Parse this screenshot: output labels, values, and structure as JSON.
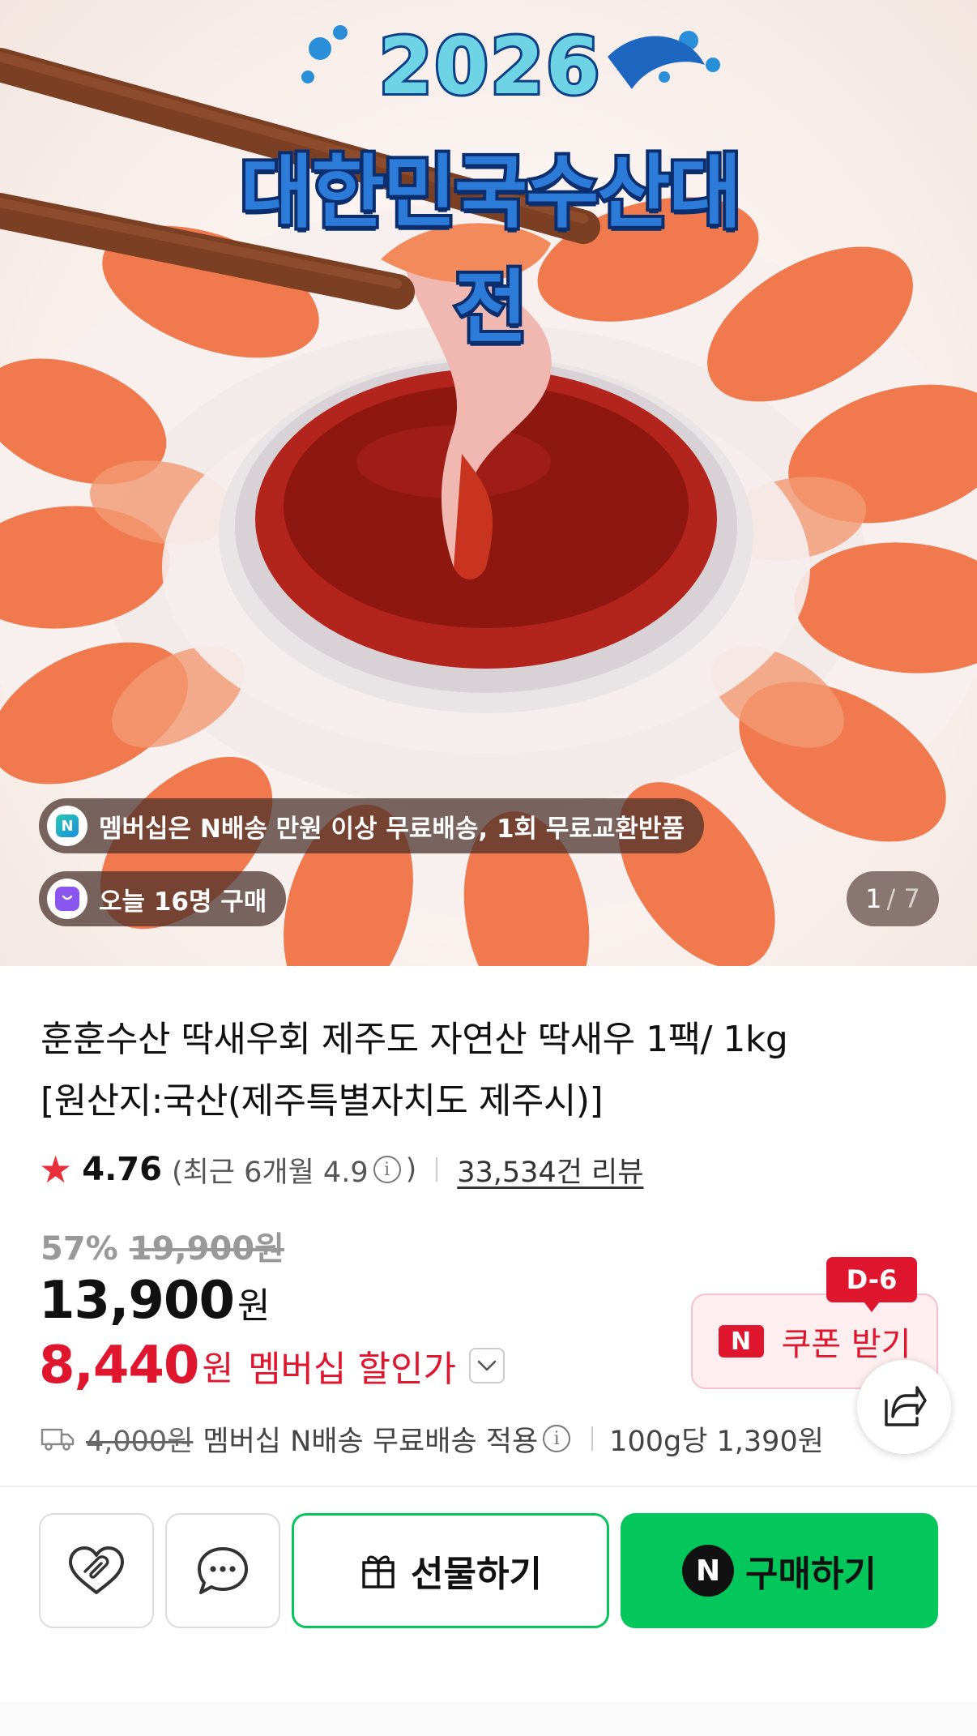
{
  "hero": {
    "event_year": "2026",
    "event_title": "대한민국수산대전",
    "membership_badge": "멤버십은 N배송 만원 이상 무료배송, 1회 무료교환반품",
    "today_purchase": "오늘 16명 구매",
    "image_index": "1",
    "image_total": "/ 7"
  },
  "product": {
    "title_line1": "훈훈수산 딱새우회 제주도 자연산 딱새우 1팩/ 1kg",
    "title_line2": "[원산지:국산(제주특별자치도 제주시)]",
    "rating": "4.76",
    "recent_rating_prefix": "(최근 6개월 4.9",
    "recent_rating_suffix": ")",
    "info_glyph": "i",
    "review_count": "33,534건 리뷰",
    "discount_rate": "57%",
    "original_price": "19,900원",
    "sale_price": "13,900",
    "currency": "원",
    "member_price": "8,440",
    "member_price_label": "멤버십 할인가",
    "shipping_fee": "4,000원",
    "shipping_note": "멤버십 N배송 무료배송 적용",
    "unit_price": "100g당 1,390원"
  },
  "coupon": {
    "dday": "D-6",
    "n_mark": "N",
    "label": "쿠폰 받기"
  },
  "actions": {
    "gift_label": "선물하기",
    "buy_label": "구매하기",
    "buy_n_mark": "N"
  },
  "colors": {
    "accent_red": "#e0152e",
    "naver_green": "#03c75a"
  },
  "icons": [
    "membership-n-icon",
    "shopping-bag-icon",
    "star-icon",
    "info-icon",
    "chevron-down-icon",
    "truck-icon",
    "share-icon",
    "heart-icon",
    "chat-bubble-icon",
    "gift-icon"
  ]
}
